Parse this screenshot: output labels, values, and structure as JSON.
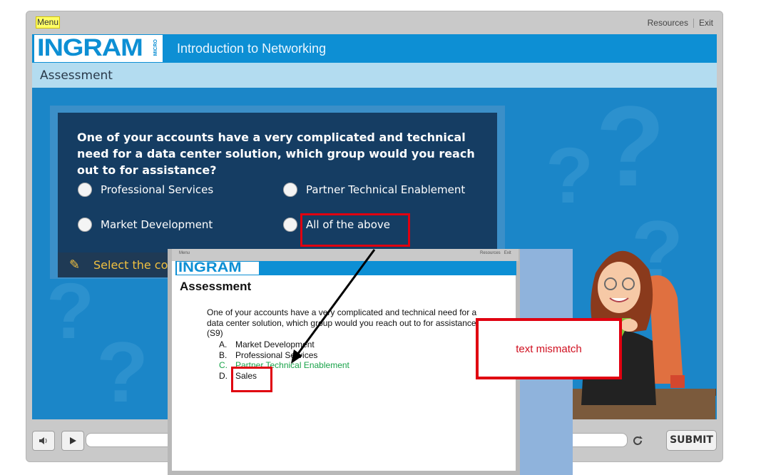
{
  "player": {
    "menu_label": "Menu",
    "resources_label": "Resources",
    "exit_label": "Exit",
    "logo_text": "INGRAM",
    "logo_sub": "MICRO",
    "course_title": "Introduction to Networking",
    "section_title": "Assessment",
    "submit_label": "SUBMIT"
  },
  "question": {
    "text": "One of your accounts have a very complicated and technical need for a data center solution, which group would you reach out to for assistance?",
    "options": [
      {
        "label": "Professional Services"
      },
      {
        "label": "Partner Technical Enablement"
      },
      {
        "label": "Market Development"
      },
      {
        "label": "All of the above"
      }
    ],
    "hint_text": "Select the cor"
  },
  "reference_doc": {
    "menu_label": "Menu",
    "resources_label": "Resources",
    "exit_label": "Exit",
    "logo_text": "INGRAM",
    "title": "Assessment",
    "question_text": "One of your accounts have a very complicated and technical need for a data center solution, which group would you reach out to for assistance? (S9)",
    "options": [
      {
        "letter": "A.",
        "label": "Market Development"
      },
      {
        "letter": "B.",
        "label": "Professional Services"
      },
      {
        "letter": "C.",
        "label": "Partner Technical Enablement"
      },
      {
        "letter": "D.",
        "label": "Sales"
      }
    ]
  },
  "annotation": {
    "note": "text mismatch",
    "color": "#e00010"
  },
  "colors": {
    "banner": "#0d8fd4",
    "stage": "#1b86c8",
    "question_panel": "#153d63",
    "correct_option": "#1aa34a",
    "hint": "#f0c040"
  },
  "icons": [
    "volume-icon",
    "play-icon",
    "replay-icon",
    "hint-icon"
  ]
}
